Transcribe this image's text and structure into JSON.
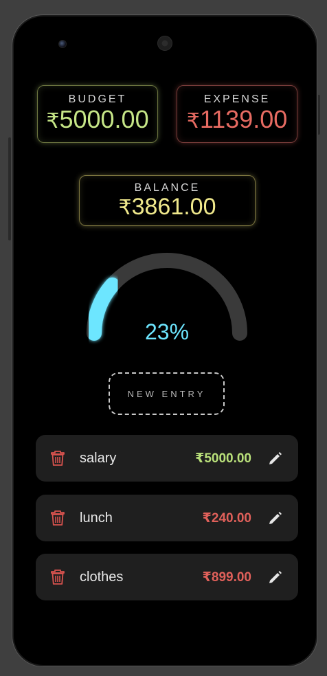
{
  "colors": {
    "budget": "#c6e687",
    "expense": "#e76b62",
    "balance": "#f0e98c",
    "gauge_fill": "#6de6ff",
    "gauge_track": "#3a3a3a",
    "income_amount": "#b9e07a",
    "expense_amount": "#e0605a",
    "delete_icon": "#d9534f",
    "edit_icon": "#e6e6e6"
  },
  "summary": {
    "budget": {
      "label": "BUDGET",
      "currency": "₹",
      "amount": "5000.00"
    },
    "expense": {
      "label": "EXPENSE",
      "currency": "₹",
      "amount": "1139.00"
    },
    "balance": {
      "label": "BALANCE",
      "currency": "₹",
      "amount": "3861.00"
    }
  },
  "gauge": {
    "percent_text": "23%",
    "fraction": 0.23
  },
  "new_entry": {
    "label": "NEW ENTRY"
  },
  "entries": [
    {
      "name": "salary",
      "amount": "₹5000.00",
      "type": "income",
      "delete_icon": "trash-icon",
      "edit_icon": "pencil-icon"
    },
    {
      "name": "lunch",
      "amount": "₹240.00",
      "type": "expense",
      "delete_icon": "trash-icon",
      "edit_icon": "pencil-icon"
    },
    {
      "name": "clothes",
      "amount": "₹899.00",
      "type": "expense",
      "delete_icon": "trash-icon",
      "edit_icon": "pencil-icon"
    }
  ]
}
